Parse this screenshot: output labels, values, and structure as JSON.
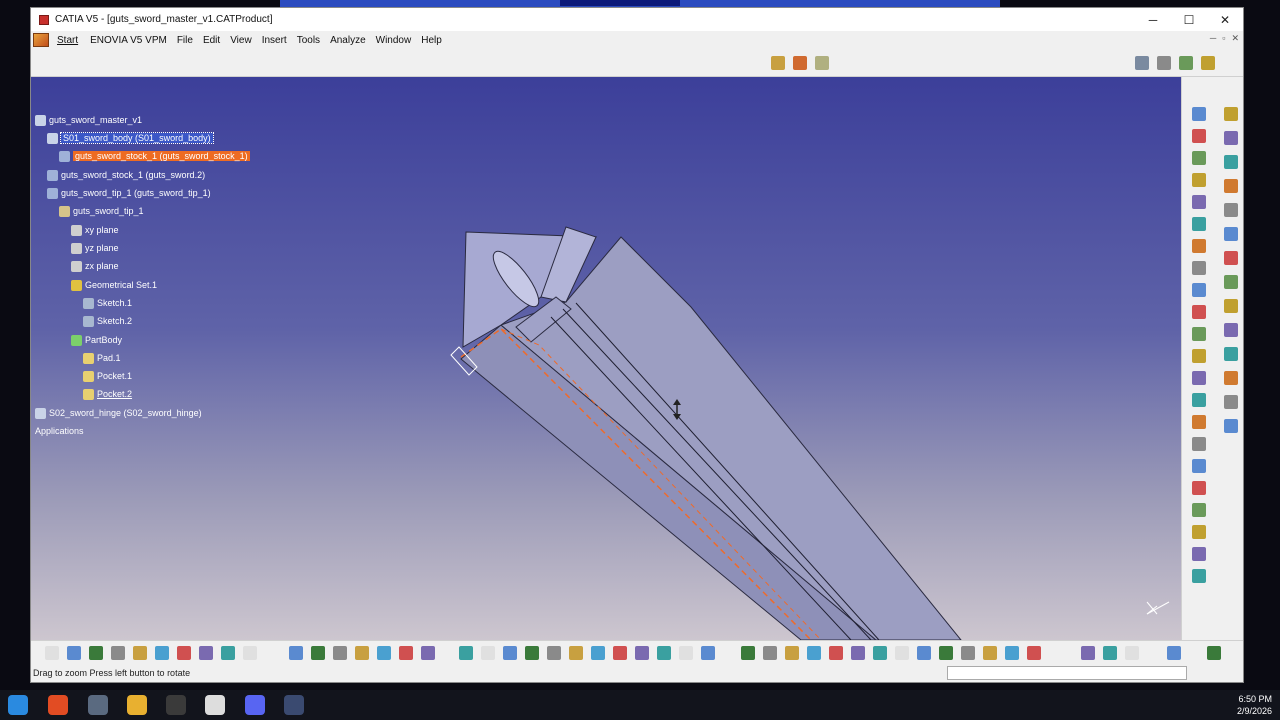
{
  "window": {
    "title": "CATIA V5 - [guts_sword_master_v1.CATProduct]",
    "controls": {
      "minimize": "─",
      "maximize": "☐",
      "close": "✕"
    }
  },
  "menubar": {
    "start": "Start",
    "items": [
      "ENOVIA V5 VPM",
      "File",
      "Edit",
      "View",
      "Insert",
      "Tools",
      "Analyze",
      "Window",
      "Help"
    ],
    "mdi_controls": [
      "─",
      "▫",
      "✕"
    ]
  },
  "tree": {
    "nodes": [
      {
        "label": "guts_sword_master_v1",
        "icon": "product-icon",
        "state": "normal"
      },
      {
        "label": "S01_sword_body (S01_sword_body)",
        "icon": "product-icon",
        "state": "selected-blue"
      },
      {
        "label": "guts_sword_stock_1 (guts_sword_stock_1)",
        "icon": "part-icon",
        "state": "selected-orange"
      },
      {
        "label": "guts_sword_stock_1 (guts_sword.2)",
        "icon": "part-icon",
        "state": "normal"
      },
      {
        "label": "guts_sword_tip_1 (guts_sword_tip_1)",
        "icon": "part-icon",
        "state": "normal"
      },
      {
        "label": "guts_sword_tip_1",
        "icon": "part-body-icon",
        "state": "normal"
      },
      {
        "label": "xy plane",
        "icon": "plane-icon",
        "state": "normal"
      },
      {
        "label": "yz plane",
        "icon": "plane-icon",
        "state": "normal"
      },
      {
        "label": "zx plane",
        "icon": "plane-icon",
        "state": "normal"
      },
      {
        "label": "Geometrical Set.1",
        "icon": "geometrical-set-icon",
        "state": "normal"
      },
      {
        "label": "Sketch.1",
        "icon": "sketch-icon",
        "state": "normal"
      },
      {
        "label": "Sketch.2",
        "icon": "sketch-icon",
        "state": "normal"
      },
      {
        "label": "PartBody",
        "icon": "partbody-gear-icon",
        "state": "normal"
      },
      {
        "label": "Pad.1",
        "icon": "pad-icon",
        "state": "normal"
      },
      {
        "label": "Pocket.1",
        "icon": "pocket-icon",
        "state": "normal"
      },
      {
        "label": "Pocket.2",
        "icon": "pocket-icon",
        "state": "underlined"
      },
      {
        "label": "S02_sword_hinge (S02_sword_hinge)",
        "icon": "product-icon",
        "state": "normal"
      },
      {
        "label": "Applications",
        "icon": "",
        "state": "normal"
      }
    ]
  },
  "colors": {
    "viewport_top": "#3c3f9a",
    "viewport_bottom": "#cdc6cf",
    "selection_blue": "#3b57c7",
    "selection_orange": "#ee6b22",
    "model_face": "#9a9cc0",
    "model_edge_highlight": "#ef6b2a"
  },
  "status": {
    "message": "Drag to zoom Press left button to rotate"
  },
  "taskbar": {
    "time": "6:50 PM",
    "date": "2/9/2026",
    "icons": [
      "windows-start-icon",
      "brave-browser-icon",
      "file-explorer-pin-icon",
      "folder-icon",
      "obs-icon",
      "chrome-icon",
      "discord-icon",
      "catia-icon"
    ]
  }
}
